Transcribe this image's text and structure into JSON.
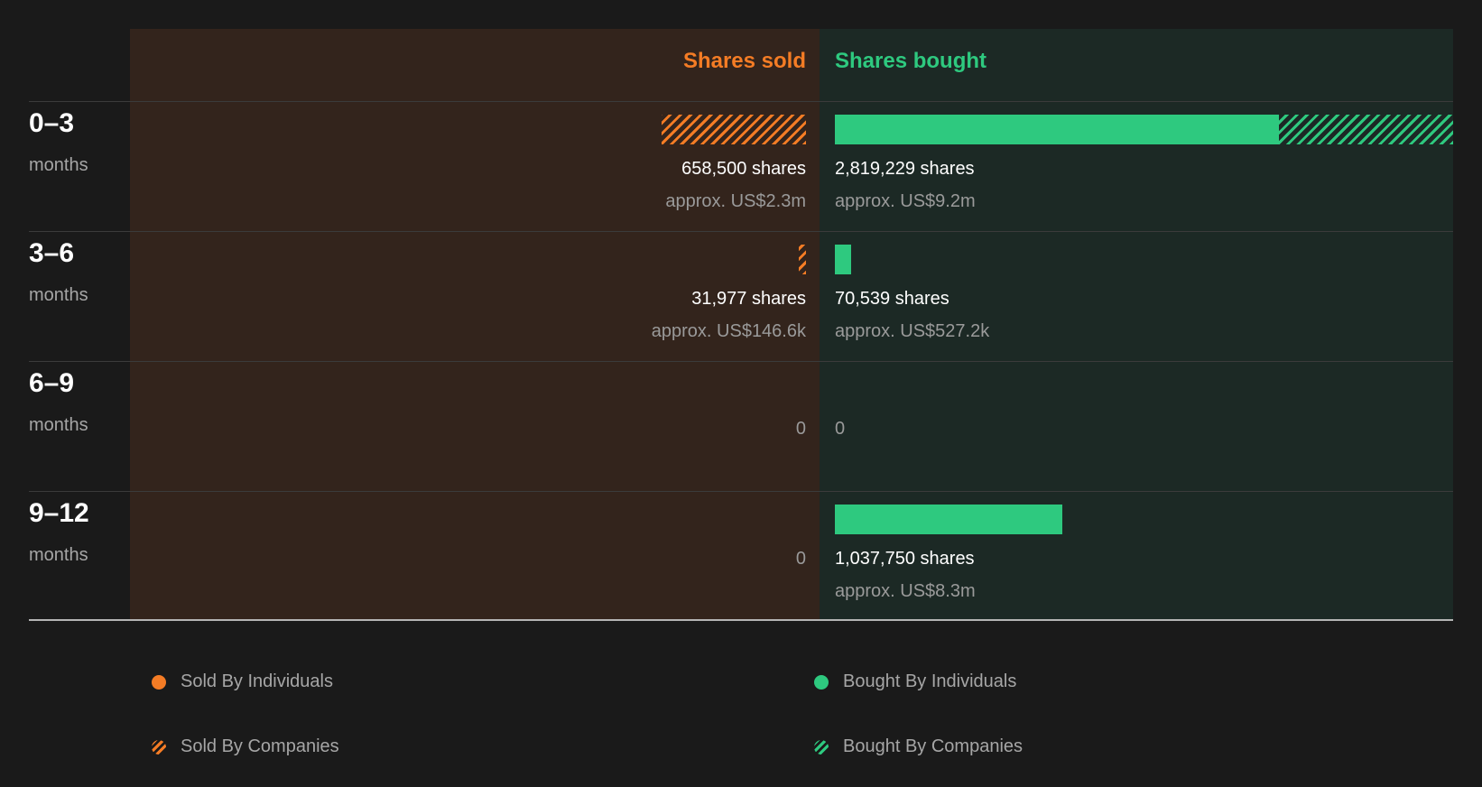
{
  "chart_data": {
    "type": "bar",
    "headers": {
      "sold": "Shares sold",
      "bought": "Shares bought"
    },
    "unit_label": "months",
    "colors": {
      "sold": "#f47c25",
      "bought": "#2ec97f",
      "sold_bg": "#33241c",
      "bought_bg": "#1c2925"
    },
    "max_shares": 2819229,
    "rows": [
      {
        "period": "0–3",
        "sold": {
          "total": 658500,
          "individuals": 0,
          "companies": 658500,
          "shares_text": "658,500 shares",
          "approx_text": "approx. US$2.3m"
        },
        "bought": {
          "total": 2819229,
          "individuals": 2023000,
          "companies": 796229,
          "shares_text": "2,819,229 shares",
          "approx_text": "approx. US$9.2m"
        }
      },
      {
        "period": "3–6",
        "sold": {
          "total": 31977,
          "individuals": 0,
          "companies": 31977,
          "shares_text": "31,977 shares",
          "approx_text": "approx. US$146.6k"
        },
        "bought": {
          "total": 70539,
          "individuals": 70539,
          "companies": 0,
          "shares_text": "70,539 shares",
          "approx_text": "approx. US$527.2k"
        }
      },
      {
        "period": "6–9",
        "sold": {
          "total": 0,
          "individuals": 0,
          "companies": 0,
          "zero_text": "0"
        },
        "bought": {
          "total": 0,
          "individuals": 0,
          "companies": 0,
          "zero_text": "0"
        }
      },
      {
        "period": "9–12",
        "sold": {
          "total": 0,
          "individuals": 0,
          "companies": 0,
          "zero_text": "0"
        },
        "bought": {
          "total": 1037750,
          "individuals": 1037750,
          "companies": 0,
          "shares_text": "1,037,750 shares",
          "approx_text": "approx. US$8.3m"
        }
      }
    ],
    "legend": [
      {
        "label": "Sold By Individuals",
        "style": "solid",
        "side": "sold"
      },
      {
        "label": "Bought By Individuals",
        "style": "solid",
        "side": "bought"
      },
      {
        "label": "Sold By Companies",
        "style": "hatch",
        "side": "sold"
      },
      {
        "label": "Bought By Companies",
        "style": "hatch",
        "side": "bought"
      }
    ]
  }
}
